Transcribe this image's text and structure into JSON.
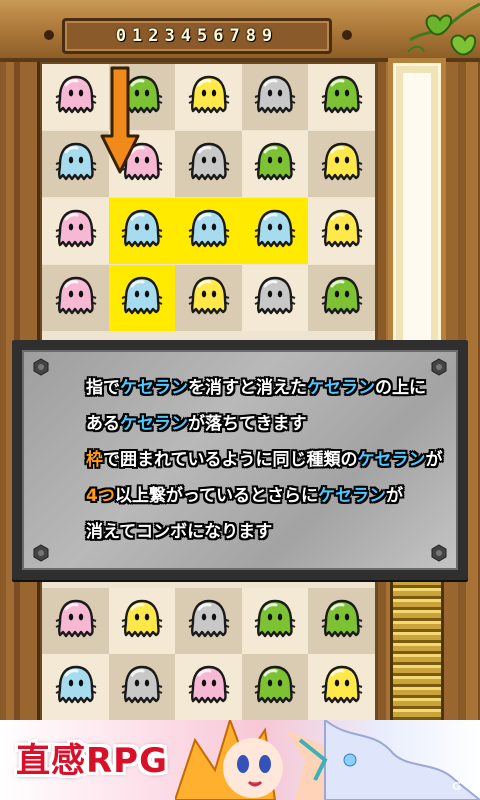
{
  "score": {
    "digits": "0123456789"
  },
  "colors": {
    "pink": "#f6b8d2",
    "green": "#7cc233",
    "yellow": "#ffe84a",
    "gray": "#c8c8c8",
    "blue": "#a6dcee",
    "highlight": "#ffea00"
  },
  "board": {
    "rows": [
      [
        "pink",
        "green",
        "yellow",
        "gray",
        "green"
      ],
      [
        "blue",
        "pink",
        "gray",
        "green",
        "yellow"
      ],
      [
        "pink",
        "blue",
        "blue",
        "blue",
        "yellow"
      ],
      [
        "pink",
        "blue",
        "yellow",
        "gray",
        "green"
      ]
    ],
    "highlighted": [
      [
        2,
        1
      ],
      [
        2,
        2
      ],
      [
        2,
        3
      ],
      [
        3,
        1
      ]
    ],
    "bottom_rows": [
      [
        "pink",
        "yellow",
        "gray",
        "green",
        "green"
      ],
      [
        "blue",
        "gray",
        "pink",
        "green",
        "yellow"
      ]
    ]
  },
  "hint_arrow": {
    "icon": "down-arrow-icon",
    "color": "#f08a1a"
  },
  "dialog": {
    "lines": [
      [
        {
          "t": "指で",
          "c": "w"
        },
        {
          "t": "ケセラン",
          "c": "b"
        },
        {
          "t": "を消すと消えた",
          "c": "w"
        },
        {
          "t": "ケセラン",
          "c": "b"
        },
        {
          "t": "の上に",
          "c": "w"
        }
      ],
      [
        {
          "t": "ある",
          "c": "w"
        },
        {
          "t": "ケセラン",
          "c": "b"
        },
        {
          "t": "が落ちてきます",
          "c": "w"
        }
      ],
      [
        {
          "t": "枠",
          "c": "o"
        },
        {
          "t": "で囲まれているように同じ種類の",
          "c": "w"
        },
        {
          "t": "ケセラン",
          "c": "b"
        },
        {
          "t": "が",
          "c": "w"
        }
      ],
      [
        {
          "t": "4つ",
          "c": "o"
        },
        {
          "t": "以上繋がっているとさらに",
          "c": "w"
        },
        {
          "t": "ケセラン",
          "c": "b"
        },
        {
          "t": "が",
          "c": "w"
        }
      ],
      [
        {
          "t": "消えてコンボになります",
          "c": "w"
        }
      ]
    ]
  },
  "banner": {
    "title": "直感RPG",
    "watermark": "G"
  }
}
